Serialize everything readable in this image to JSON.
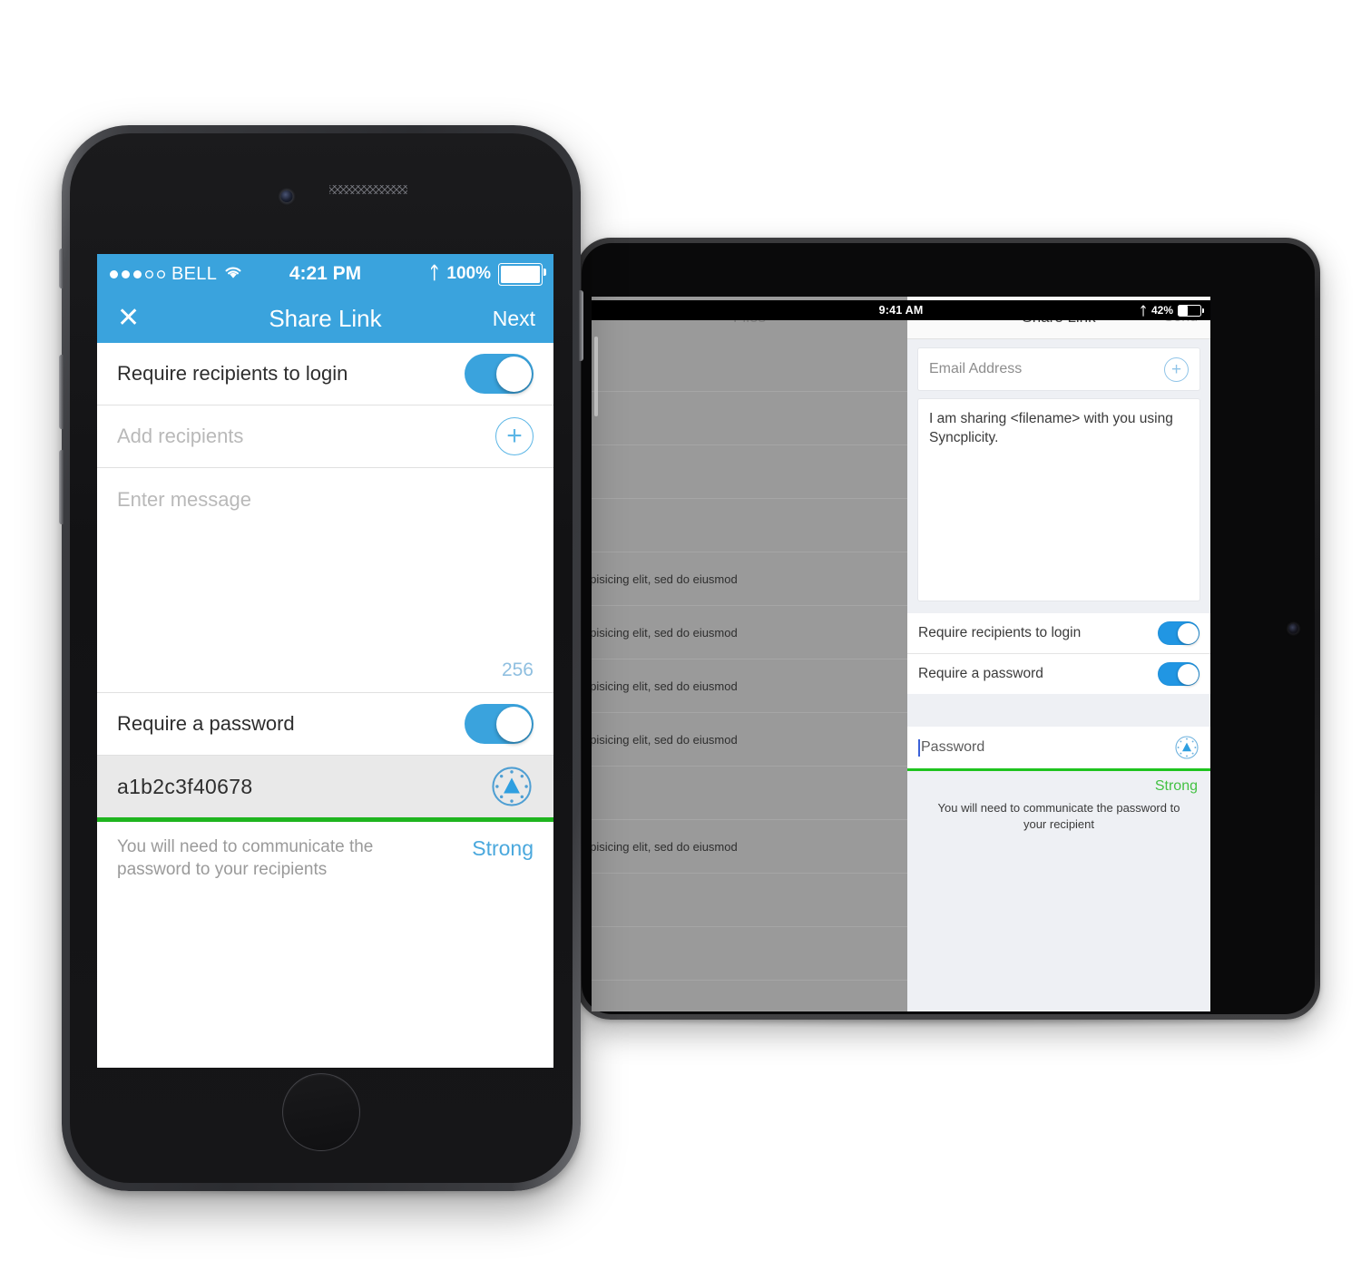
{
  "phone": {
    "status_bar": {
      "signal_filled": 3,
      "signal_empty": 2,
      "carrier": "BELL",
      "wifi_icon": "wifi-icon",
      "time": "4:21 PM",
      "bluetooth_icon": "bluetooth-icon",
      "battery_percent": "100%",
      "battery_level": 100
    },
    "nav": {
      "close_icon": "close-icon",
      "close_label": "✕",
      "title": "Share Link",
      "next_label": "Next"
    },
    "rows": {
      "require_login_label": "Require recipients to login",
      "require_login_on": true,
      "add_recipients_placeholder": "Add recipients",
      "add_recipient_icon": "plus-circle-icon",
      "add_recipient_glyph": "+",
      "message_placeholder": "Enter message",
      "char_count": "256",
      "require_password_label": "Require a password",
      "require_password_on": true,
      "password_value": "a1b2c3f40678",
      "generate_icon": "password-generator-icon",
      "strength_bar_color": "#1fb51f",
      "note": "You will need to communicate the password to your recipients",
      "strength_label": "Strong",
      "strength_color": "#4aa8dd"
    }
  },
  "tablet": {
    "status_bar": {
      "time": "9:41 AM",
      "bluetooth_icon": "bluetooth-icon",
      "battery_percent": "42%",
      "battery_level": 42
    },
    "files_pane": {
      "title": "Files",
      "rows": [
        "",
        "",
        "",
        "",
        "tur adipisicing elit, sed do eiusmod",
        "tur adipisicing elit, sed do eiusmod",
        "tur adipisicing elit, sed do eiusmod",
        "tur adipisicing elit, sed do eiusmod",
        "",
        "tur adipisicing elit, sed do eiusmod",
        "",
        ""
      ]
    },
    "share_pane": {
      "title": "Share Link",
      "send_label": "Send",
      "email_placeholder": "Email Address",
      "add_recipient_icon": "plus-circle-icon",
      "add_recipient_glyph": "+",
      "message_text": "I am sharing <filename> with you using Syncplicity.",
      "require_login_label": "Require recipients to login",
      "require_login_on": true,
      "require_password_label": "Require a password",
      "require_password_on": true,
      "password_placeholder": "Password",
      "generate_icon": "password-generator-icon",
      "strength_bar_color": "#1fc41f",
      "strength_label": "Strong",
      "strength_color": "#43c143",
      "note": "You will need to communicate the password to your recipient"
    }
  },
  "theme": {
    "accent_blue": "#3aa3dd",
    "toggle_blue": "#2196e3",
    "strength_green": "#1fb51f",
    "placeholder_gray": "#b9b9b9"
  }
}
